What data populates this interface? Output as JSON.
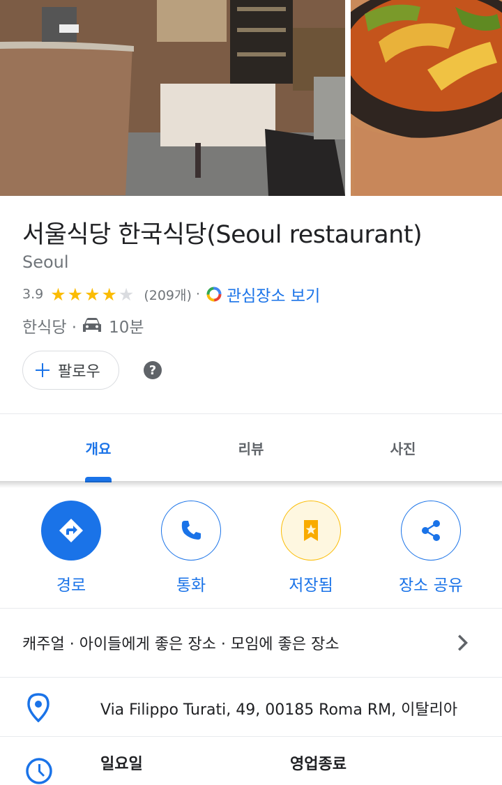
{
  "photos": {
    "left_alt": "restaurant-interior-photo",
    "right_alt": "food-dish-photo"
  },
  "place": {
    "title": "서울식당 한국식당(Seoul restaurant)",
    "subtitle": "Seoul",
    "rating": "3.9",
    "stars": 3.9,
    "review_count": "(209개)",
    "separator": "·",
    "interest_link": "관심장소 보기",
    "category": "한식당 ·",
    "drive_time": "10분",
    "follow_label": "팔로우"
  },
  "tabs": [
    {
      "label": "개요",
      "active": true
    },
    {
      "label": "리뷰",
      "active": false
    },
    {
      "label": "사진",
      "active": false
    }
  ],
  "actions": [
    {
      "label": "경로",
      "icon": "directions-icon"
    },
    {
      "label": "통화",
      "icon": "phone-icon"
    },
    {
      "label": "저장됨",
      "icon": "saved-bookmark-icon"
    },
    {
      "label": "장소 공유",
      "icon": "share-icon"
    }
  ],
  "info": {
    "attributes": "캐주얼 · 아이들에게 좋은 장소 · 모임에 좋은 장소",
    "address": "Via Filippo Turati, 49, 00185 Roma RM, 이탈리아",
    "hours_day": "일요일",
    "hours_status": "영업종료"
  },
  "colors": {
    "accent": "#1a73e8",
    "star": "#fbbc04",
    "muted_text": "#70757a"
  }
}
